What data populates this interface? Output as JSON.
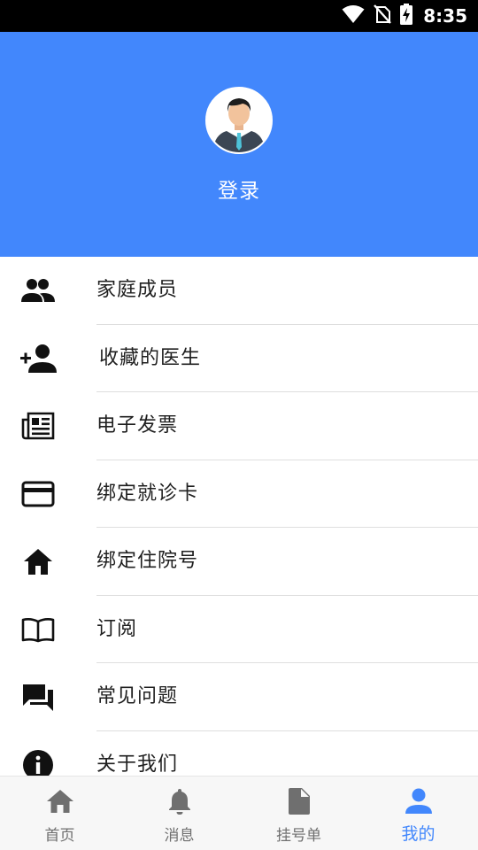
{
  "status_bar": {
    "time": "8:35",
    "icons": [
      "wifi-icon",
      "no-sim-icon",
      "battery-charging-icon"
    ]
  },
  "header": {
    "avatar_icon": "user-avatar",
    "login_label": "登录",
    "background": "#4287fc"
  },
  "menu": {
    "items": [
      {
        "label": "家庭成员",
        "icon": "people-icon"
      },
      {
        "label": "收藏的医生",
        "icon": "person-add-icon"
      },
      {
        "label": "电子发票",
        "icon": "newspaper-icon"
      },
      {
        "label": "绑定就诊卡",
        "icon": "credit-card-icon"
      },
      {
        "label": "绑定住院号",
        "icon": "home-icon"
      },
      {
        "label": "订阅",
        "icon": "book-icon"
      },
      {
        "label": "常见问题",
        "icon": "chat-icon"
      },
      {
        "label": "关于我们",
        "icon": "info-icon"
      }
    ]
  },
  "tabbar": {
    "active_color": "#4287fc",
    "tabs": [
      {
        "label": "首页",
        "icon": "home-icon",
        "active": false
      },
      {
        "label": "消息",
        "icon": "bell-icon",
        "active": false
      },
      {
        "label": "挂号单",
        "icon": "document-icon",
        "active": false
      },
      {
        "label": "我的",
        "icon": "person-icon",
        "active": true
      }
    ]
  }
}
